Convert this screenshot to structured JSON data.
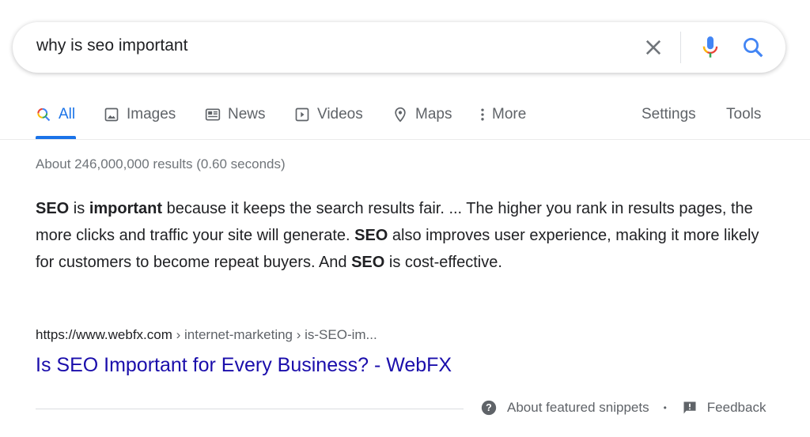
{
  "search": {
    "query": "why is seo important",
    "clear_icon": "close-icon",
    "mic_icon": "mic-icon",
    "search_icon": "search-icon"
  },
  "tabs": [
    {
      "label": "All",
      "icon": "search-multicolor-icon",
      "active": true
    },
    {
      "label": "Images",
      "icon": "image-icon"
    },
    {
      "label": "News",
      "icon": "news-icon"
    },
    {
      "label": "Videos",
      "icon": "video-icon"
    },
    {
      "label": "Maps",
      "icon": "map-pin-icon"
    },
    {
      "label": "More",
      "icon": "more-vert-icon"
    }
  ],
  "tools": {
    "settings": "Settings",
    "tools": "Tools"
  },
  "result_stats": "About 246,000,000 results (0.60 seconds)",
  "snippet": [
    {
      "text": "SEO",
      "bold": true
    },
    {
      "text": " is "
    },
    {
      "text": "important",
      "bold": true
    },
    {
      "text": " because it keeps the search results fair. ... The higher you rank in results pages, the more clicks and traffic your site will generate. "
    },
    {
      "text": "SEO",
      "bold": true
    },
    {
      "text": " also improves user experience, making it more likely for customers to become repeat buyers. And "
    },
    {
      "text": "SEO",
      "bold": true
    },
    {
      "text": " is cost-effective."
    }
  ],
  "result": {
    "url_host": "https://www.webfx.com",
    "url_path": " › internet-marketing › is-SEO-im...",
    "title": "Is SEO Important for Every Business? - WebFX"
  },
  "footer": {
    "about": "About featured snippets",
    "dot": "•",
    "feedback": "Feedback"
  },
  "colors": {
    "accent": "#1a73e8",
    "link": "#1a0dab",
    "muted": "#70757a"
  }
}
